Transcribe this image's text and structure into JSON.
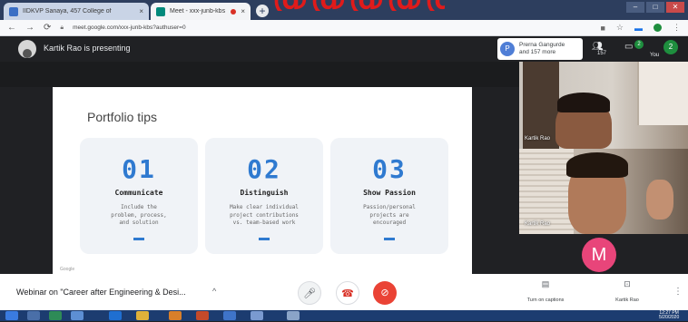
{
  "browser": {
    "tabs": [
      {
        "title": "IIDKVP Sanaya, 457 College of",
        "active": false
      },
      {
        "title": "Meet - xxx-junb-kbs",
        "active": true
      }
    ],
    "url": "meet.google.com/xxx-junb-kbs?authuser=0"
  },
  "meet": {
    "presenter_text": "Kartik Rao is presenting",
    "participants_chip": {
      "initial": "P",
      "text": "Prerna Gangurde\nand 157 more"
    },
    "participant_count": "157",
    "chat_badge": "2",
    "self_label": "You",
    "self_initial": "2"
  },
  "slide": {
    "title": "Portfolio tips",
    "cards": [
      {
        "num": "01",
        "name": "Communicate",
        "desc": "Include the\nproblem, process,\nand solution"
      },
      {
        "num": "02",
        "name": "Distinguish",
        "desc": "Make clear individual\nproject contributions\nvs. team-based work"
      },
      {
        "num": "03",
        "name": "Show Passion",
        "desc": "Passion/personal\nprojects are\nencouraged"
      }
    ],
    "footer": "Google"
  },
  "tiles": [
    {
      "label": "Kartik Rao"
    },
    {
      "label": "Kartik Rao"
    },
    {
      "initial": "M"
    }
  ],
  "bottom": {
    "meeting_name": "Webinar on \"Career after Engineering & Desi...",
    "captions_label": "Turn on captions",
    "presenting_label": "Kartik Rao\nis presenting"
  },
  "taskbar": {
    "clock": "12:27 PM\n5/20/2020"
  },
  "colors": {
    "accent": "#2f7ad0",
    "end_call": "#d93025",
    "avatar_m": "#e8457a"
  }
}
